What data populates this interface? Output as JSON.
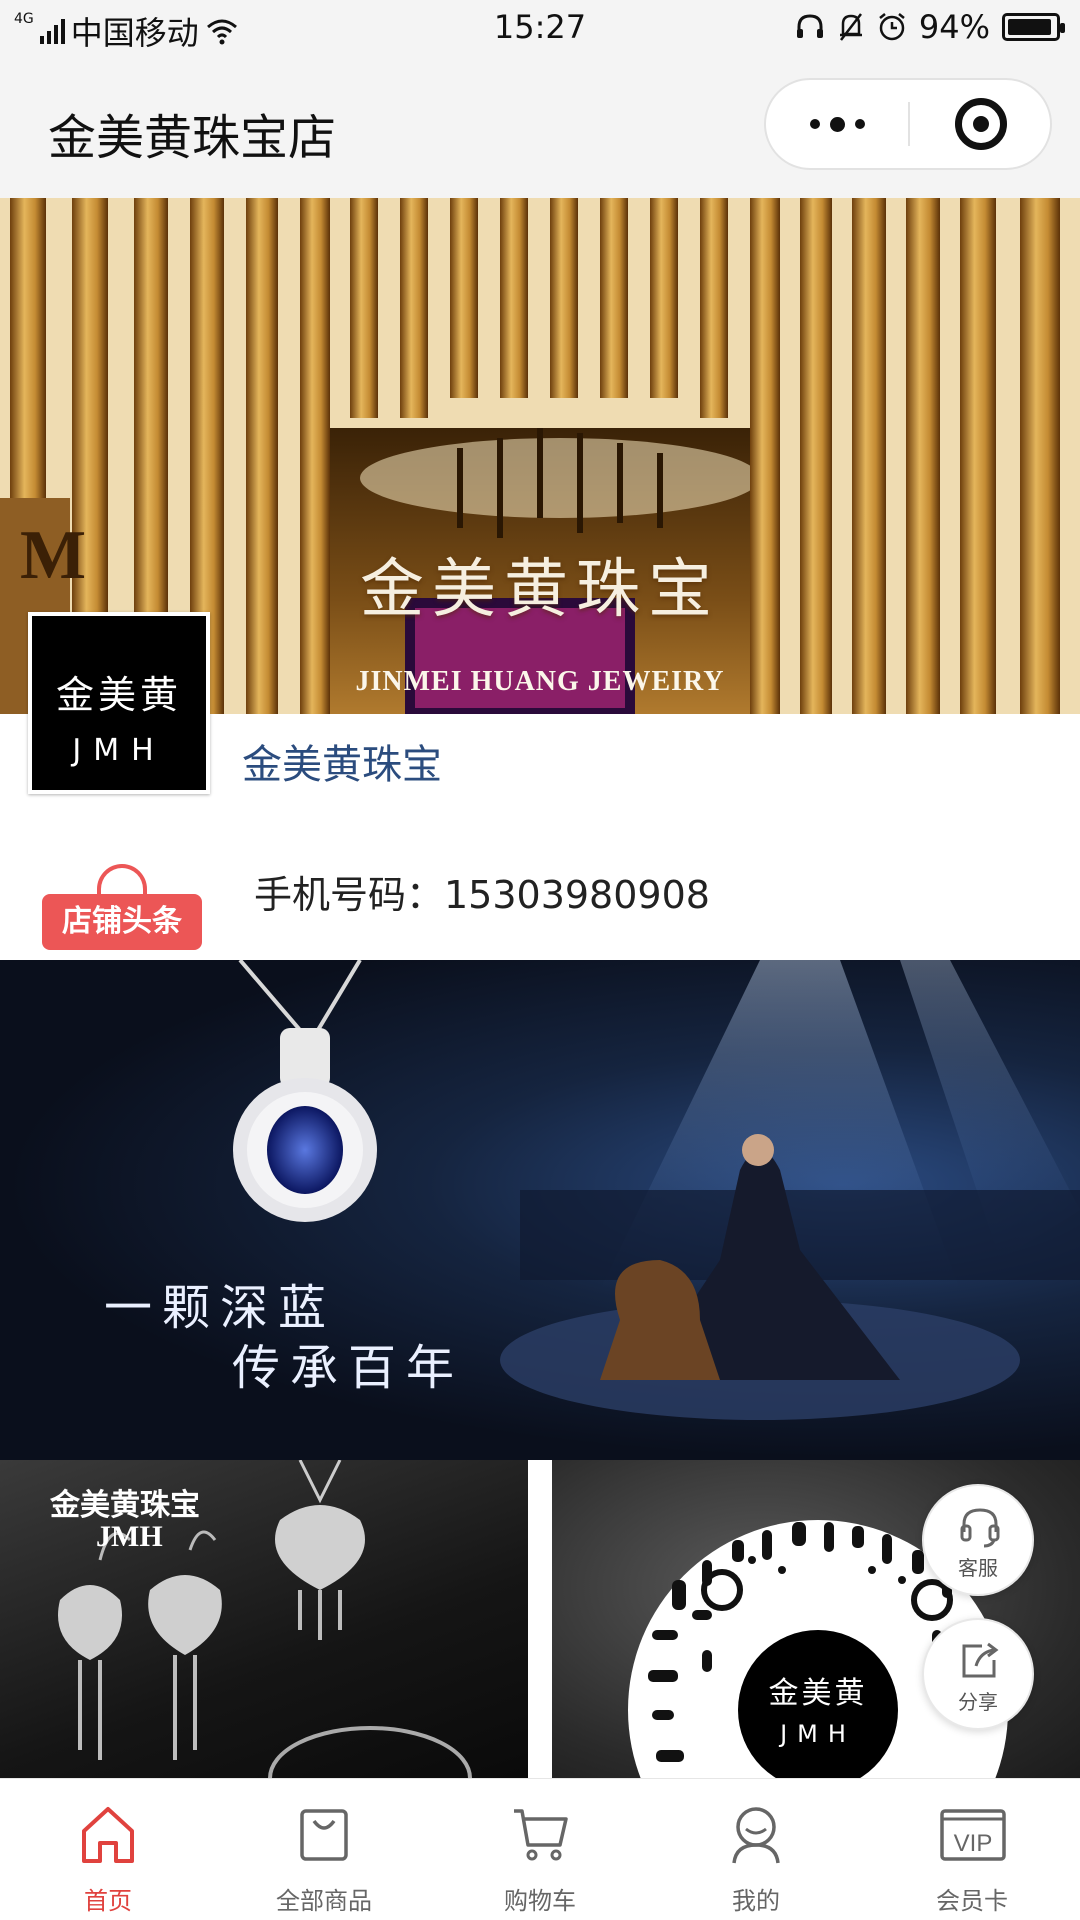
{
  "status_bar": {
    "network": "4G",
    "carrier": "中国移动",
    "time": "15:27",
    "battery": "94%",
    "battery_level": 0.94
  },
  "nav": {
    "title": "金美黄珠宝店"
  },
  "hero": {
    "sign_cn": "金美黄珠宝",
    "sign_en": "JINMEI HUANG JEWEIRY"
  },
  "store": {
    "logo_line1": "金美黄",
    "logo_line2": "JMH",
    "name": "金美黄珠宝"
  },
  "notice": {
    "badge_label": "店铺头条",
    "text": "手机号码：15303980908"
  },
  "banner": {
    "line1": "一颗深蓝",
    "line2": "传承百年"
  },
  "tile_left": {
    "title_line1": "金美黄珠宝",
    "title_line2": "JMH"
  },
  "tile_right": {
    "qr_line1": "金美黄",
    "qr_line2": "JMH"
  },
  "floating": {
    "service_label": "客服",
    "share_label": "分享"
  },
  "tabs": [
    {
      "label": "首页",
      "icon": "home-icon",
      "active": true
    },
    {
      "label": "全部商品",
      "icon": "bag-icon",
      "active": false
    },
    {
      "label": "购物车",
      "icon": "cart-icon",
      "active": false
    },
    {
      "label": "我的",
      "icon": "user-icon",
      "active": false
    },
    {
      "label": "会员卡",
      "icon": "vip-card-icon",
      "active": false
    }
  ],
  "colors": {
    "accent": "#e0423e",
    "store_name": "#2b4c7e",
    "badge": "#ec5656"
  }
}
